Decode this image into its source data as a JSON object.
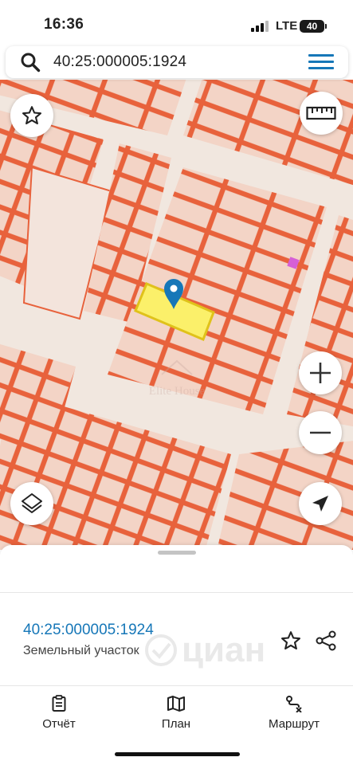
{
  "status_bar": {
    "time": "16:36",
    "network": "LTE",
    "battery": "40"
  },
  "search": {
    "query": "40:25:000005:1924"
  },
  "map": {
    "watermark_logo": "Elite House"
  },
  "sheet": {
    "parcel_id": "40:25:000005:1924",
    "parcel_type": "Земельный участок",
    "watermark_logo": "циан"
  },
  "tabs": [
    {
      "label": "Отчёт",
      "icon": "report-icon"
    },
    {
      "label": "План",
      "icon": "map-plan-icon"
    },
    {
      "label": "Маршрут",
      "icon": "route-icon"
    }
  ],
  "colors": {
    "accent": "#1677b8",
    "parcel_line": "#e8623c",
    "parcel_fill": "#f3d4c6",
    "road": "#f1e7df",
    "selected_parcel": "#fbf06a",
    "selected_outline": "#e0c21a",
    "pin": "#1677b8"
  }
}
